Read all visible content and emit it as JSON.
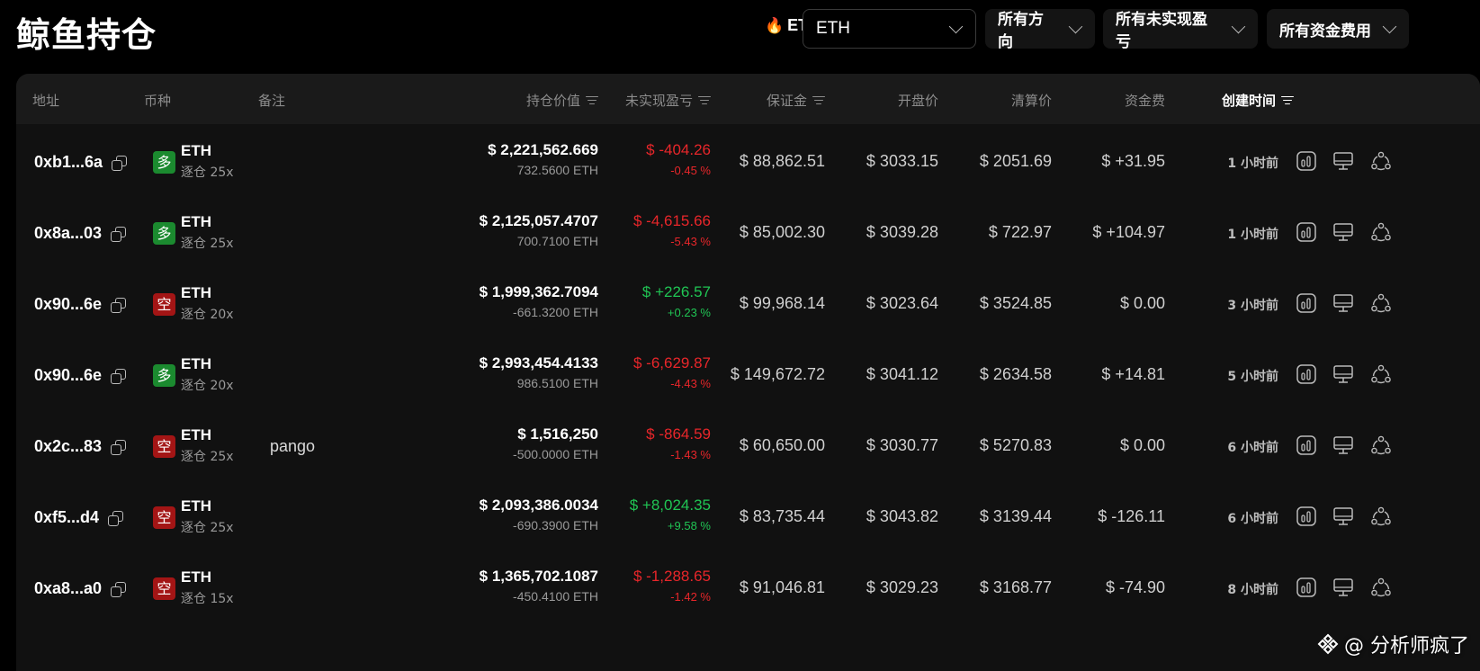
{
  "page_title": "鲸鱼持仓",
  "hot_coin": "ETH",
  "filters": {
    "coin_select": "ETH",
    "direction": "所有方向",
    "pnl": "所有未实现盈亏",
    "funding": "所有资金费用"
  },
  "columns": {
    "address": "地址",
    "coin": "币种",
    "note": "备注",
    "value": "持仓价值",
    "pnl": "未实现盈亏",
    "margin": "保证金",
    "open_price": "开盘价",
    "liq_price": "清算价",
    "funding": "资金费",
    "created": "创建时间"
  },
  "rows": [
    {
      "address": "0xb1...6a",
      "side_label": "多",
      "side": "long",
      "coin": "ETH",
      "leverage": "逐仓 25x",
      "note": "",
      "value": "$ 2,221,562.669",
      "size": "732.5600 ETH",
      "pnl": "$ -404.26",
      "pnl_pct": "-0.45 %",
      "pnl_sign": "neg",
      "margin": "$ 88,862.51",
      "open": "$ 3033.15",
      "liq": "$ 2051.69",
      "funding": "$ +31.95",
      "funding_sign": "pos",
      "time": "1 小时前"
    },
    {
      "address": "0x8a...03",
      "side_label": "多",
      "side": "long",
      "coin": "ETH",
      "leverage": "逐仓 25x",
      "note": "",
      "value": "$ 2,125,057.4707",
      "size": "700.7100 ETH",
      "pnl": "$ -4,615.66",
      "pnl_pct": "-5.43 %",
      "pnl_sign": "neg",
      "margin": "$ 85,002.30",
      "open": "$ 3039.28",
      "liq": "$ 722.97",
      "funding": "$ +104.97",
      "funding_sign": "pos",
      "time": "1 小时前"
    },
    {
      "address": "0x90...6e",
      "side_label": "空",
      "side": "short",
      "coin": "ETH",
      "leverage": "逐仓 20x",
      "note": "",
      "value": "$ 1,999,362.7094",
      "size": "-661.3200 ETH",
      "pnl": "$ +226.57",
      "pnl_pct": "+0.23 %",
      "pnl_sign": "pos",
      "margin": "$ 99,968.14",
      "open": "$ 3023.64",
      "liq": "$ 3524.85",
      "funding": "$ 0.00",
      "funding_sign": "zero",
      "time": "3 小时前"
    },
    {
      "address": "0x90...6e",
      "side_label": "多",
      "side": "long",
      "coin": "ETH",
      "leverage": "逐仓 20x",
      "note": "",
      "value": "$ 2,993,454.4133",
      "size": "986.5100 ETH",
      "pnl": "$ -6,629.87",
      "pnl_pct": "-4.43 %",
      "pnl_sign": "neg",
      "margin": "$ 149,672.72",
      "open": "$ 3041.12",
      "liq": "$ 2634.58",
      "funding": "$ +14.81",
      "funding_sign": "pos",
      "time": "5 小时前"
    },
    {
      "address": "0x2c...83",
      "side_label": "空",
      "side": "short",
      "coin": "ETH",
      "leverage": "逐仓 25x",
      "note": "pango",
      "value": "$ 1,516,250",
      "size": "-500.0000 ETH",
      "pnl": "$ -864.59",
      "pnl_pct": "-1.43 %",
      "pnl_sign": "neg",
      "margin": "$ 60,650.00",
      "open": "$ 3030.77",
      "liq": "$ 5270.83",
      "funding": "$ 0.00",
      "funding_sign": "zero",
      "time": "6 小时前"
    },
    {
      "address": "0xf5...d4",
      "side_label": "空",
      "side": "short",
      "coin": "ETH",
      "leverage": "逐仓 25x",
      "note": "",
      "value": "$ 2,093,386.0034",
      "size": "-690.3900 ETH",
      "pnl": "$ +8,024.35",
      "pnl_pct": "+9.58 %",
      "pnl_sign": "pos",
      "margin": "$ 83,735.44",
      "open": "$ 3043.82",
      "liq": "$ 3139.44",
      "funding": "$ -126.11",
      "funding_sign": "neg",
      "time": "6 小时前"
    },
    {
      "address": "0xa8...a0",
      "side_label": "空",
      "side": "short",
      "coin": "ETH",
      "leverage": "逐仓 15x",
      "note": "",
      "value": "$ 1,365,702.1087",
      "size": "-450.4100 ETH",
      "pnl": "$ -1,288.65",
      "pnl_pct": "-1.42 %",
      "pnl_sign": "neg",
      "margin": "$ 91,046.81",
      "open": "$ 3029.23",
      "liq": "$ 3168.77",
      "funding": "$ -74.90",
      "funding_sign": "neg",
      "time": "8 小时前"
    }
  ],
  "watermark": "@ 分析师疯了",
  "colors": {
    "positive": "#20c554",
    "negative": "#e8262a",
    "long_badge": "#1b8a2f",
    "short_badge": "#a31515",
    "background": "#000000",
    "panel": "#111111"
  },
  "icons": [
    "copy-icon",
    "chart-icon",
    "monitor-icon",
    "share-icon",
    "flame-icon",
    "binance-logo-icon"
  ]
}
